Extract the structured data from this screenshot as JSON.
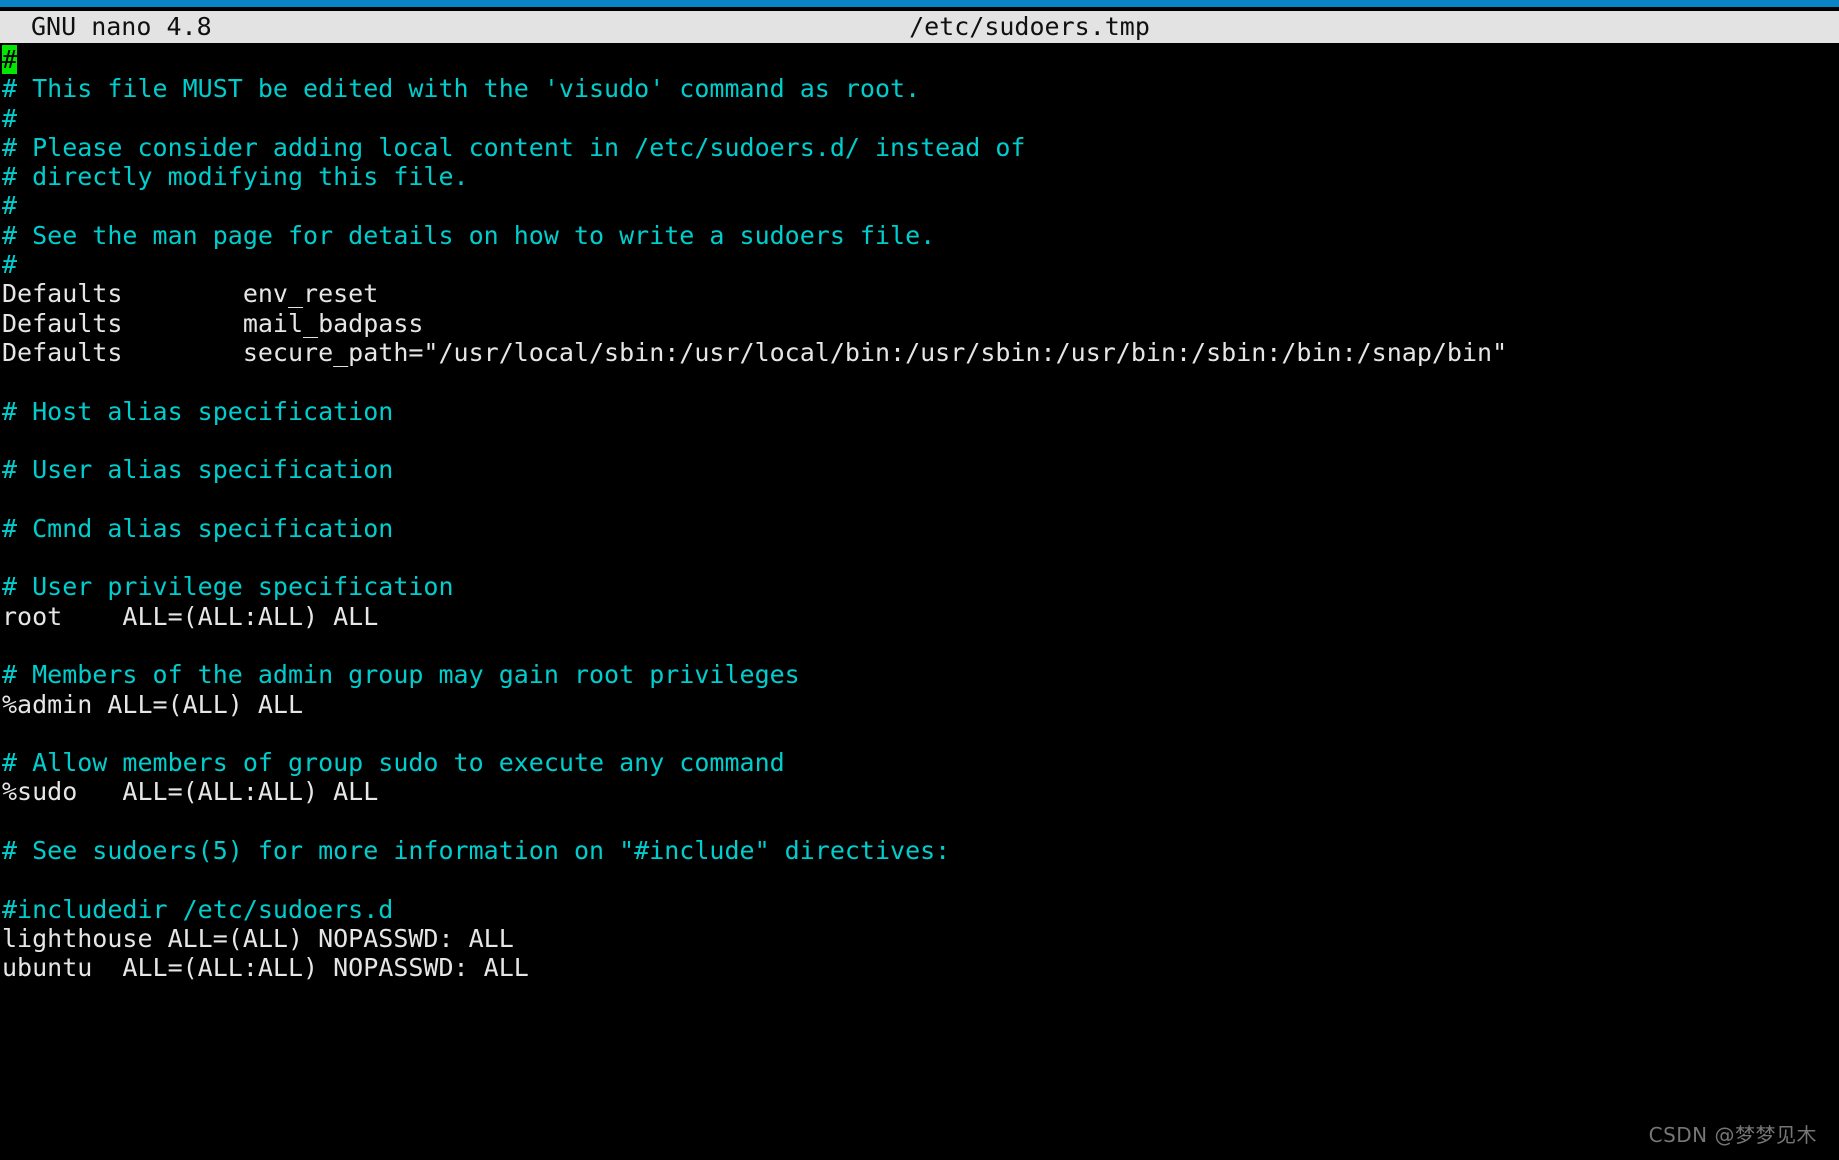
{
  "app": {
    "name": "GNU nano",
    "version_label": "GNU nano 4.8",
    "filename": "/etc/sudoers.tmp"
  },
  "theme": {
    "accent_bar": "#0a84c8",
    "titlebar_bg": "#e3e3e3",
    "titlebar_fg": "#101010",
    "terminal_bg": "#000000",
    "comment_color": "#00cdcd",
    "text_color": "#e6e6e6",
    "cursor_bg": "#00e800",
    "cursor_fg": "#000000"
  },
  "cursor": {
    "char": "#",
    "line": 1,
    "column": 1
  },
  "editor": {
    "lines": [
      {
        "id": 1,
        "kind": "comment",
        "cursor": true,
        "cursor_char": "#",
        "text": ""
      },
      {
        "id": 2,
        "kind": "comment",
        "text": "# This file MUST be edited with the 'visudo' command as root."
      },
      {
        "id": 3,
        "kind": "comment",
        "text": "#"
      },
      {
        "id": 4,
        "kind": "comment",
        "text": "# Please consider adding local content in /etc/sudoers.d/ instead of"
      },
      {
        "id": 5,
        "kind": "comment",
        "text": "# directly modifying this file."
      },
      {
        "id": 6,
        "kind": "comment",
        "text": "#"
      },
      {
        "id": 7,
        "kind": "comment",
        "text": "# See the man page for details on how to write a sudoers file."
      },
      {
        "id": 8,
        "kind": "comment",
        "text": "#"
      },
      {
        "id": 9,
        "kind": "text",
        "text": "Defaults        env_reset"
      },
      {
        "id": 10,
        "kind": "text",
        "text": "Defaults        mail_badpass"
      },
      {
        "id": 11,
        "kind": "text",
        "text": "Defaults        secure_path=\"/usr/local/sbin:/usr/local/bin:/usr/sbin:/usr/bin:/sbin:/bin:/snap/bin\""
      },
      {
        "id": 12,
        "kind": "blank",
        "text": ""
      },
      {
        "id": 13,
        "kind": "comment",
        "text": "# Host alias specification"
      },
      {
        "id": 14,
        "kind": "blank",
        "text": ""
      },
      {
        "id": 15,
        "kind": "comment",
        "text": "# User alias specification"
      },
      {
        "id": 16,
        "kind": "blank",
        "text": ""
      },
      {
        "id": 17,
        "kind": "comment",
        "text": "# Cmnd alias specification"
      },
      {
        "id": 18,
        "kind": "blank",
        "text": ""
      },
      {
        "id": 19,
        "kind": "comment",
        "text": "# User privilege specification"
      },
      {
        "id": 20,
        "kind": "text",
        "text": "root    ALL=(ALL:ALL) ALL"
      },
      {
        "id": 21,
        "kind": "blank",
        "text": ""
      },
      {
        "id": 22,
        "kind": "comment",
        "text": "# Members of the admin group may gain root privileges"
      },
      {
        "id": 23,
        "kind": "text",
        "text": "%admin ALL=(ALL) ALL"
      },
      {
        "id": 24,
        "kind": "blank",
        "text": ""
      },
      {
        "id": 25,
        "kind": "comment",
        "text": "# Allow members of group sudo to execute any command"
      },
      {
        "id": 26,
        "kind": "text",
        "text": "%sudo   ALL=(ALL:ALL) ALL"
      },
      {
        "id": 27,
        "kind": "blank",
        "text": ""
      },
      {
        "id": 28,
        "kind": "comment",
        "text": "# See sudoers(5) for more information on \"#include\" directives:"
      },
      {
        "id": 29,
        "kind": "blank",
        "text": ""
      },
      {
        "id": 30,
        "kind": "comment",
        "text": "#includedir /etc/sudoers.d"
      },
      {
        "id": 31,
        "kind": "text",
        "text": "lighthouse ALL=(ALL) NOPASSWD: ALL"
      },
      {
        "id": 32,
        "kind": "text",
        "text": "ubuntu  ALL=(ALL:ALL) NOPASSWD: ALL"
      }
    ]
  },
  "watermark": {
    "text": "CSDN @梦梦见木"
  }
}
